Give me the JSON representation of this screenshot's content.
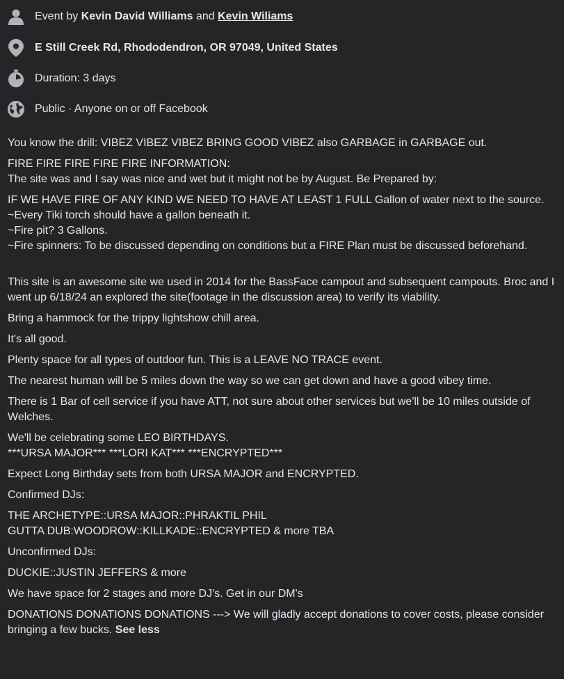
{
  "details": {
    "host": {
      "prefix": "Event by ",
      "name1": "Kevin David Williams",
      "joiner": " and ",
      "name2": "Kevin Wiliams",
      "icon": "person-icon"
    },
    "location": {
      "text": "E Still Creek Rd, Rhododendron, OR 97049, United States",
      "icon": "location-pin-icon"
    },
    "duration": {
      "text": "Duration: 3 days",
      "icon": "stopwatch-icon"
    },
    "privacy": {
      "text": "Public · Anyone on or off Facebook",
      "icon": "globe-icon"
    }
  },
  "description": {
    "p1": "You know the drill: VIBEZ VIBEZ VIBEZ BRING GOOD VIBEZ also GARBAGE in GARBAGE out.",
    "p2_l1": "FIRE FIRE FIRE FIRE FIRE INFORMATION:",
    "p2_l2": "The site was and I say was nice and wet but it might not be by August. Be Prepared by:",
    "p3_l1": "IF WE HAVE FIRE OF ANY KIND WE NEED TO HAVE AT LEAST 1 FULL Gallon of water next to the source.",
    "p3_l2": "~Every Tiki torch should have a gallon beneath it.",
    "p3_l3": "~Fire pit? 3 Gallons.",
    "p3_l4": "~Fire spinners: To be discussed depending on conditions but a FIRE Plan must be discussed beforehand.",
    "p4": "This site is an awesome site we used in 2014 for the BassFace campout and subsequent campouts. Broc and I went up 6/18/24 an explored the site(footage in the discussion area) to verify its viability.",
    "p5": "Bring a hammock for the trippy lightshow chill area.",
    "p6": "It's all good.",
    "p7": "Plenty space for all types of outdoor fun. This is a LEAVE NO TRACE event.",
    "p8": "The nearest human will be 5 miles down the way so we can get down and have a good vibey time.",
    "p9": "There is 1 Bar of cell service if you have ATT, not sure about other services but we'll be 10 miles outside of Welches.",
    "p10_l1": "We'll be celebrating some LEO BIRTHDAYS.",
    "p10_l2": "***URSA MAJOR*** ***LORI KAT*** ***ENCRYPTED***",
    "p11": "Expect Long Birthday sets from both URSA MAJOR and ENCRYPTED.",
    "p12": "Confirmed DJs:",
    "p13_l1": "THE ARCHETYPE::URSA MAJOR::PHRAKTIL PHIL",
    "p13_l2": "GUTTA DUB:WOODROW::KILLKADE::ENCRYPTED & more TBA",
    "p14": "Unconfirmed DJs:",
    "p15": "DUCKIE::JUSTIN JEFFERS & more",
    "p16": "We have space for 2 stages and more DJ's. Get in our DM's",
    "p17": "DONATIONS DONATIONS DONATIONS ---> We will gladly accept donations to cover costs, please consider bringing a few bucks.",
    "see_less": "See less"
  },
  "colors": {
    "background": "#242526",
    "text": "#e4e6eb",
    "icon": "#b0b3b8"
  }
}
